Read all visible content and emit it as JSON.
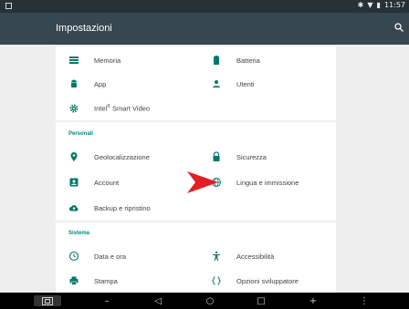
{
  "statusbar": {
    "clock": "11:57"
  },
  "appbar": {
    "title": "Impostazioni"
  },
  "colors": {
    "accent": "#00897b",
    "appbar": "#37474f",
    "statusbar": "#263238",
    "icon": "#00796b",
    "arrow": "#e31e24"
  },
  "device": [
    {
      "label": "Memoria",
      "icon": "storage-icon"
    },
    {
      "label": "Batteria",
      "icon": "battery-icon"
    },
    {
      "label": "App",
      "icon": "android-icon"
    },
    {
      "label": "Utenti",
      "icon": "person-icon"
    },
    {
      "label": "Intel",
      "label_suffix": " Smart Video",
      "sup": "®",
      "icon": "gear-icon"
    }
  ],
  "personal": {
    "header": "Personali",
    "items": [
      {
        "label": "Geolocalizzazione",
        "icon": "location-pin-icon"
      },
      {
        "label": "Sicurezza",
        "icon": "lock-icon"
      },
      {
        "label": "Account",
        "icon": "account-box-icon"
      },
      {
        "label": "Lingua e immissione",
        "icon": "globe-icon"
      },
      {
        "label": "Backup e ripristino",
        "icon": "cloud-upload-icon"
      }
    ]
  },
  "system": {
    "header": "Sistema",
    "items": [
      {
        "label": "Data e ora",
        "icon": "clock-icon"
      },
      {
        "label": "Accessibilità",
        "icon": "accessibility-icon"
      },
      {
        "label": "Stampa",
        "icon": "printer-icon"
      },
      {
        "label": "Opzioni sviluppatore",
        "icon": "braces-icon"
      }
    ]
  }
}
